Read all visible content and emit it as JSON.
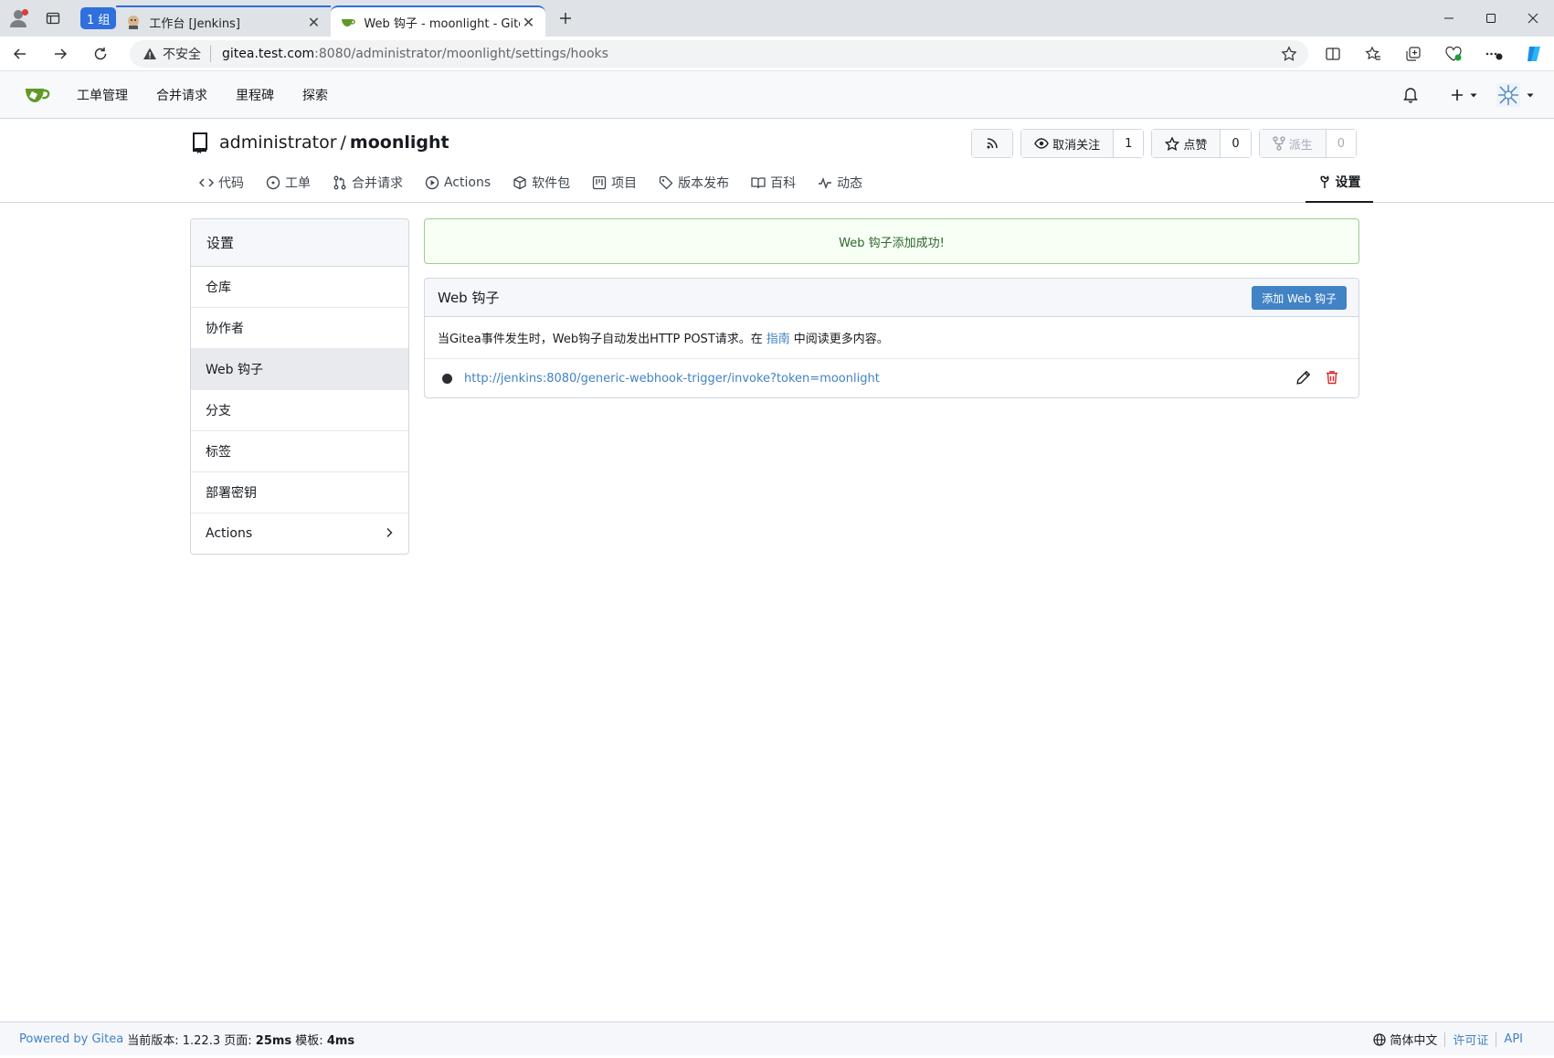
{
  "browser": {
    "group_badge": "1 组",
    "tabs": [
      {
        "title": "工作台 [Jenkins]",
        "active": false
      },
      {
        "title": "Web 钩子 - moonlight - Gitea: Git with a cup of tea",
        "active": true
      }
    ],
    "address": {
      "insecure_label": "不安全",
      "host": "gitea.test.com",
      "path": ":8080/administrator/moonlight/settings/hooks"
    }
  },
  "navbar": {
    "links": [
      "工单管理",
      "合并请求",
      "里程碑",
      "探索"
    ]
  },
  "repo": {
    "owner": "administrator",
    "slash": "/",
    "name": "moonlight",
    "watch_label": "取消关注",
    "watch_count": "1",
    "star_label": "点赞",
    "star_count": "0",
    "fork_label": "派生",
    "fork_count": "0",
    "tabs": {
      "code": "代码",
      "issues": "工单",
      "pulls": "合并请求",
      "actions": "Actions",
      "packages": "软件包",
      "projects": "项目",
      "releases": "版本发布",
      "wiki": "百科",
      "activity": "动态"
    },
    "settings_tab": "设置"
  },
  "sidebar": {
    "header": "设置",
    "items": [
      "仓库",
      "协作者",
      "Web 钩子",
      "分支",
      "标签",
      "部署密钥",
      "Actions"
    ],
    "active_index": 2
  },
  "flash": {
    "message": "Web 钩子添加成功!"
  },
  "webhooks": {
    "title": "Web 钩子",
    "add_button": "添加 Web 钩子",
    "desc_before": "当Gitea事件发生时，Web钩子自动发出HTTP POST请求。在",
    "desc_link": "指南",
    "desc_after": "中阅读更多内容。",
    "hooks": [
      {
        "url": "http://jenkins:8080/generic-webhook-trigger/invoke?token=moonlight"
      }
    ]
  },
  "footer": {
    "powered": "Powered by Gitea",
    "version_label": "当前版本: 1.22.3",
    "page_label": "页面:",
    "page_time": "25ms",
    "template_label": "模板:",
    "template_time": "4ms",
    "language": "简体中文",
    "license": "许可证",
    "api": "API"
  },
  "colors": {
    "primary": "#4183c4",
    "success_text": "#2c662d",
    "danger": "#db2828",
    "gitea_green": "#609926"
  }
}
